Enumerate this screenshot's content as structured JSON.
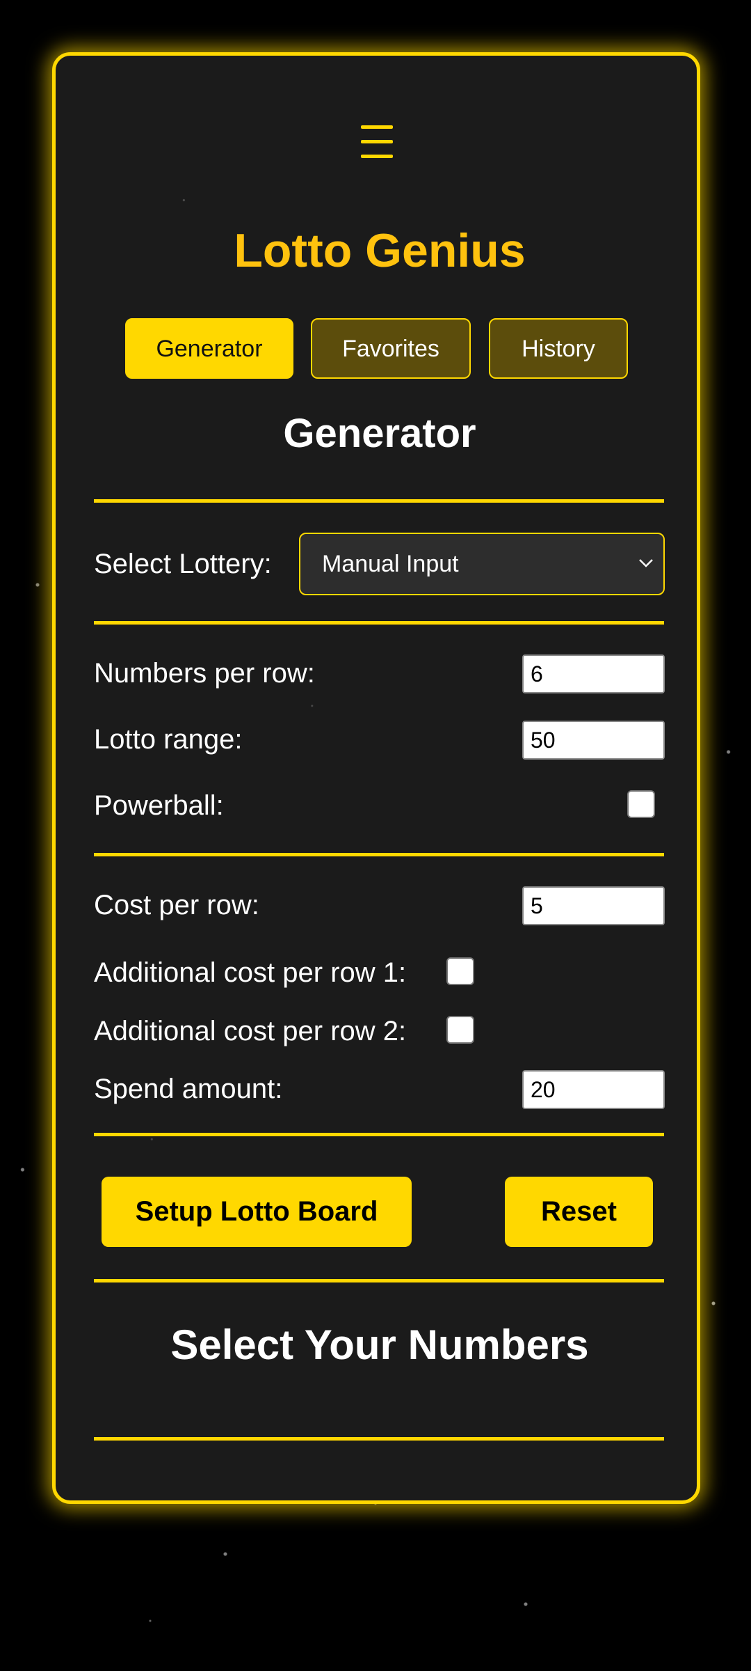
{
  "app": {
    "title": "Lotto Genius",
    "accent_color": "#ffd800",
    "title_color": "#ffc20e"
  },
  "menu": {
    "icon": "hamburger-menu-icon"
  },
  "tabs": [
    {
      "label": "Generator",
      "active": true
    },
    {
      "label": "Favorites",
      "active": false
    },
    {
      "label": "History",
      "active": false
    }
  ],
  "generator": {
    "heading": "Generator",
    "select_lottery_label": "Select Lottery:",
    "select_lottery_value": "Manual Input",
    "select_icon": "chevron-down-icon",
    "numbers_per_row_label": "Numbers per row:",
    "numbers_per_row_value": "6",
    "lotto_range_label": "Lotto range:",
    "lotto_range_value": "50",
    "powerball_label": "Powerball:",
    "powerball_checked": false,
    "cost_per_row_label": "Cost per row:",
    "cost_per_row_value": "5",
    "additional_cost_1_label": "Additional cost per row 1:",
    "additional_cost_1_checked": false,
    "additional_cost_2_label": "Additional cost per row 2:",
    "additional_cost_2_checked": false,
    "spend_amount_label": "Spend amount:",
    "spend_amount_value": "20",
    "setup_button": "Setup Lotto Board",
    "reset_button": "Reset"
  },
  "select_numbers": {
    "heading": "Select Your Numbers"
  }
}
